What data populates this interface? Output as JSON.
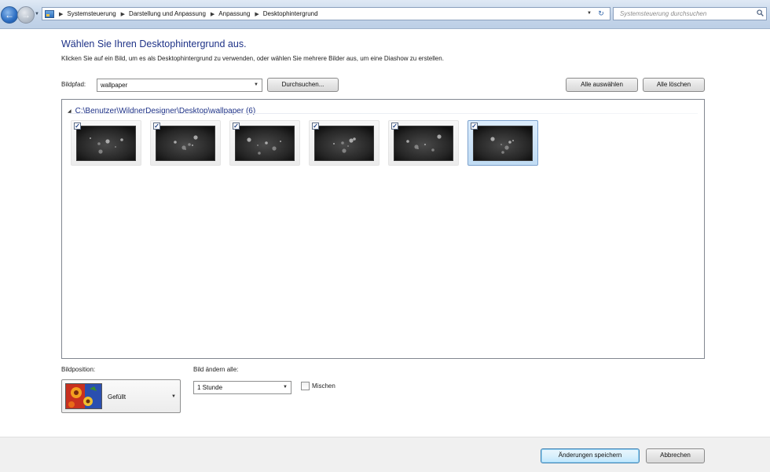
{
  "address_bar": {
    "breadcrumbs": [
      "Systemsteuerung",
      "Darstellung und Anpassung",
      "Anpassung",
      "Desktophintergrund"
    ],
    "search_placeholder": "Systemsteuerung durchsuchen",
    "icons": [
      "back-arrow-icon",
      "forward-arrow-icon",
      "control-panel-icon",
      "refresh-icon",
      "search-icon"
    ]
  },
  "main": {
    "title": "Wählen Sie Ihren Desktophintergrund aus.",
    "subtitle": "Klicken Sie auf ein Bild, um es als Desktophintergrund zu verwenden, oder wählen Sie mehrere Bilder aus, um eine Diashow zu erstellen.",
    "image_path_label": "Bildpfad:",
    "image_path_value": "wallpaper",
    "browse_button": "Durchsuchen...",
    "select_all_button": "Alle auswählen",
    "clear_all_button": "Alle löschen"
  },
  "gallery": {
    "group_title": "C:\\Benutzer\\WildnerDesigner\\Desktop\\wallpaper (6)",
    "thumbnails": [
      {
        "checked": true,
        "selected": false
      },
      {
        "checked": true,
        "selected": false
      },
      {
        "checked": true,
        "selected": false
      },
      {
        "checked": true,
        "selected": false
      },
      {
        "checked": true,
        "selected": false
      },
      {
        "checked": true,
        "selected": true
      }
    ]
  },
  "bottom": {
    "position_label": "Bildposition:",
    "position_value": "Gefüllt",
    "interval_label": "Bild ändern alle:",
    "interval_value": "1 Stunde",
    "shuffle_label": "Mischen",
    "shuffle_checked": false
  },
  "footer": {
    "save_button": "Änderungen speichern",
    "cancel_button": "Abbrechen"
  }
}
